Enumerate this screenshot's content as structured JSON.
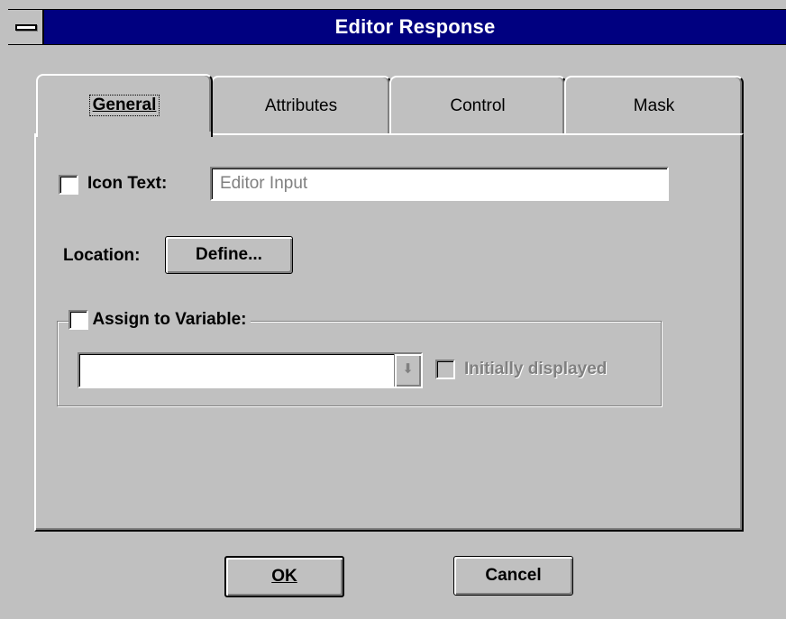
{
  "window": {
    "title": "Editor Response"
  },
  "tabs": [
    {
      "label": "General",
      "active": true
    },
    {
      "label": "Attributes",
      "active": false
    },
    {
      "label": "Control",
      "active": false
    },
    {
      "label": "Mask",
      "active": false
    }
  ],
  "general": {
    "icon_text": {
      "label": "Icon Text:",
      "checked": false,
      "value": "Editor Input"
    },
    "location": {
      "label": "Location:",
      "button_label": "Define..."
    },
    "assign_to_variable": {
      "label": "Assign to Variable:",
      "checked": false,
      "variable_value": "",
      "initially_displayed": {
        "label": "Initially displayed",
        "checked": false,
        "enabled": false
      }
    }
  },
  "buttons": {
    "ok_label": "OK",
    "cancel_label": "Cancel"
  },
  "colors": {
    "titlebar": "#000080",
    "face": "#c0c0c0"
  },
  "icons": {
    "system_menu": "system-menu-icon",
    "dropdown_arrow": "dropdown-arrow-icon"
  }
}
